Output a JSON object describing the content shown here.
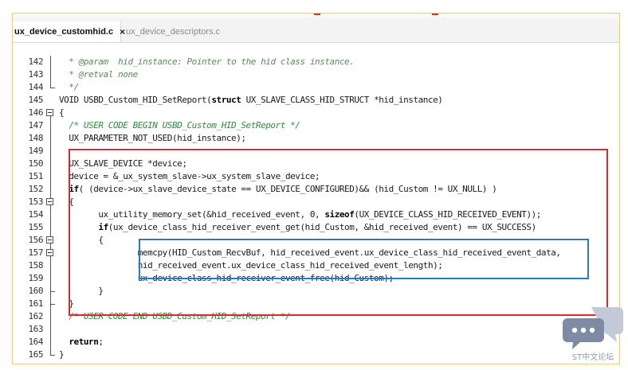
{
  "tabs": [
    {
      "label": "ux_device_customhid.c",
      "active": true,
      "close_glyph": "×"
    },
    {
      "label": "ux_device_descriptors.c",
      "active": false
    }
  ],
  "editor": {
    "lines": [
      {
        "n": "142",
        "tokens": [
          {
            "t": "  * ",
            "c": "doc"
          },
          {
            "t": "@param",
            "c": "doc"
          },
          {
            "t": "  hid_instance: Pointer to the hid class instance.",
            "c": "doc"
          }
        ]
      },
      {
        "n": "143",
        "tokens": [
          {
            "t": "  * ",
            "c": "doc"
          },
          {
            "t": "@retval",
            "c": "doc"
          },
          {
            "t": " none",
            "c": "doc"
          }
        ]
      },
      {
        "n": "144",
        "tokens": [
          {
            "t": "  */",
            "c": "doc"
          }
        ]
      },
      {
        "n": "145",
        "tokens": [
          {
            "t": "VOID USBD_Custom_HID_SetReport(",
            "c": "plain"
          },
          {
            "t": "struct",
            "c": "kw"
          },
          {
            "t": " UX_SLAVE_CLASS_HID_STRUCT *hid_instance)",
            "c": "plain"
          }
        ]
      },
      {
        "n": "146",
        "tokens": [
          {
            "t": "{",
            "c": "plain"
          }
        ]
      },
      {
        "n": "147",
        "tokens": [
          {
            "t": "  /* USER CODE BEGIN USBD_Custom_HID_SetReport */",
            "c": "comment"
          }
        ]
      },
      {
        "n": "148",
        "tokens": [
          {
            "t": "  UX_PARAMETER_NOT_USED(hid_instance);",
            "c": "plain"
          }
        ]
      },
      {
        "n": "149",
        "tokens": []
      },
      {
        "n": "150",
        "tokens": [
          {
            "t": "  UX_SLAVE_DEVICE *device;",
            "c": "plain"
          }
        ]
      },
      {
        "n": "151",
        "tokens": [
          {
            "t": "  device = &_ux_system_slave->ux_system_slave_device;",
            "c": "plain"
          }
        ]
      },
      {
        "n": "152",
        "tokens": [
          {
            "t": "  ",
            "c": "plain"
          },
          {
            "t": "if",
            "c": "kw"
          },
          {
            "t": "( (device->ux_slave_device_state == UX_DEVICE_CONFIGURED)&& (hid_Custom != UX_NULL) )",
            "c": "plain"
          }
        ]
      },
      {
        "n": "153",
        "tokens": [
          {
            "t": "  {",
            "c": "plain"
          }
        ]
      },
      {
        "n": "154",
        "tokens": [
          {
            "t": "        ux_utility_memory_set(&hid_received_event, ",
            "c": "plain"
          },
          {
            "t": "0",
            "c": "num"
          },
          {
            "t": ", ",
            "c": "plain"
          },
          {
            "t": "sizeof",
            "c": "kw"
          },
          {
            "t": "(UX_DEVICE_CLASS_HID_RECEIVED_EVENT));",
            "c": "plain"
          }
        ]
      },
      {
        "n": "155",
        "tokens": [
          {
            "t": "        ",
            "c": "plain"
          },
          {
            "t": "if",
            "c": "kw"
          },
          {
            "t": "(ux_device_class_hid_receiver_event_get(hid_Custom, &hid_received_event) == UX_SUCCESS)",
            "c": "plain"
          }
        ]
      },
      {
        "n": "156",
        "tokens": [
          {
            "t": "        {",
            "c": "plain"
          }
        ]
      },
      {
        "n": "157",
        "tokens": [
          {
            "t": "                memcpy(HID_Custom_RecvBuf, hid_received_event.ux_device_class_hid_received_event_data,",
            "c": "plain"
          }
        ]
      },
      {
        "n": "158",
        "tokens": [
          {
            "t": "                hid_received_event.ux_device_class_hid_received_event_length);",
            "c": "plain"
          }
        ]
      },
      {
        "n": "159",
        "tokens": [
          {
            "t": "                ux_device_class_hid_receiver_event_free(hid_Custom);",
            "c": "plain"
          }
        ]
      },
      {
        "n": "160",
        "tokens": [
          {
            "t": "        }",
            "c": "plain"
          }
        ]
      },
      {
        "n": "161",
        "tokens": [
          {
            "t": "  }",
            "c": "plain"
          }
        ]
      },
      {
        "n": "162",
        "tokens": [
          {
            "t": "  /* USER CODE END USBD_Custom_HID_SetReport */",
            "c": "comment"
          }
        ]
      },
      {
        "n": "163",
        "tokens": []
      },
      {
        "n": "164",
        "tokens": [
          {
            "t": "  ",
            "c": "plain"
          },
          {
            "t": "return",
            "c": "kw"
          },
          {
            "t": ";",
            "c": "plain"
          }
        ]
      },
      {
        "n": "165",
        "tokens": [
          {
            "t": "}",
            "c": "plain"
          }
        ]
      }
    ]
  },
  "colors": {
    "highlight_outer": "#e0232c",
    "highlight_inner": "#2a7ab8",
    "comment": "#2e8b3a"
  },
  "watermark": {
    "text": "ST中文论坛",
    "icon": "chat-bubble-icon"
  }
}
